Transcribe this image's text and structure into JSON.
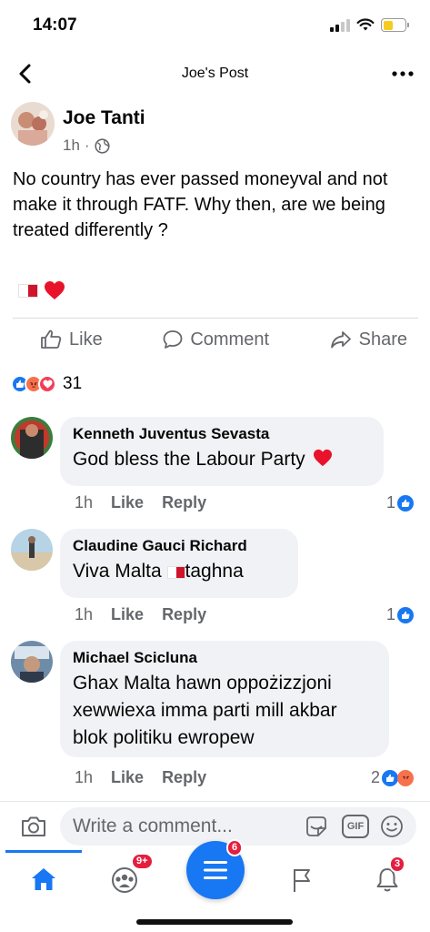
{
  "status_bar": {
    "time": "14:07",
    "battery_color": "#f5cc1e"
  },
  "header": {
    "title": "Joe's Post",
    "back_icon": "chevron-left-icon",
    "more_icon": "ellipsis-icon"
  },
  "post": {
    "author": "Joe Tanti",
    "time": "1h",
    "separator": "·",
    "privacy_icon": "globe-icon",
    "text": "No country has ever passed moneyval and not make it through FATF. Why then, are we being treated differently ?",
    "emojis": [
      "malta-flag",
      "red-heart"
    ],
    "actions": {
      "like": "Like",
      "comment": "Comment",
      "share": "Share"
    },
    "reactions": {
      "types": [
        "like",
        "angry",
        "love"
      ],
      "count": "31"
    }
  },
  "comments": [
    {
      "name": "Kenneth Juventus Sevasta",
      "text": "God bless the Labour Party",
      "text_emoji": "red-heart",
      "time": "1h",
      "like_label": "Like",
      "reply_label": "Reply",
      "reaction_count": "1",
      "reaction_types": [
        "like"
      ]
    },
    {
      "name": "Claudine Gauci Richard",
      "text_before": "Viva Malta",
      "text_after": "taghna",
      "time": "1h",
      "like_label": "Like",
      "reply_label": "Reply",
      "reaction_count": "1",
      "reaction_types": [
        "like"
      ]
    },
    {
      "name": "Michael Scicluna",
      "text": "Ghax Malta hawn oppożizzjoni xewwiexa imma parti mill akbar blok politiku ewropew",
      "time": "1h",
      "like_label": "Like",
      "reply_label": "Reply",
      "reaction_count": "2",
      "reaction_types": [
        "like",
        "angry"
      ]
    }
  ],
  "composer": {
    "placeholder": "Write a comment...",
    "gif_label": "GIF"
  },
  "tabbar": {
    "groups_badge": "9+",
    "menu_badge": "6",
    "notifications_badge": "3"
  },
  "colors": {
    "accent": "#1877f2",
    "badge": "#e41e3f",
    "bubble": "#f0f2f5",
    "secondary_text": "#65676b"
  }
}
